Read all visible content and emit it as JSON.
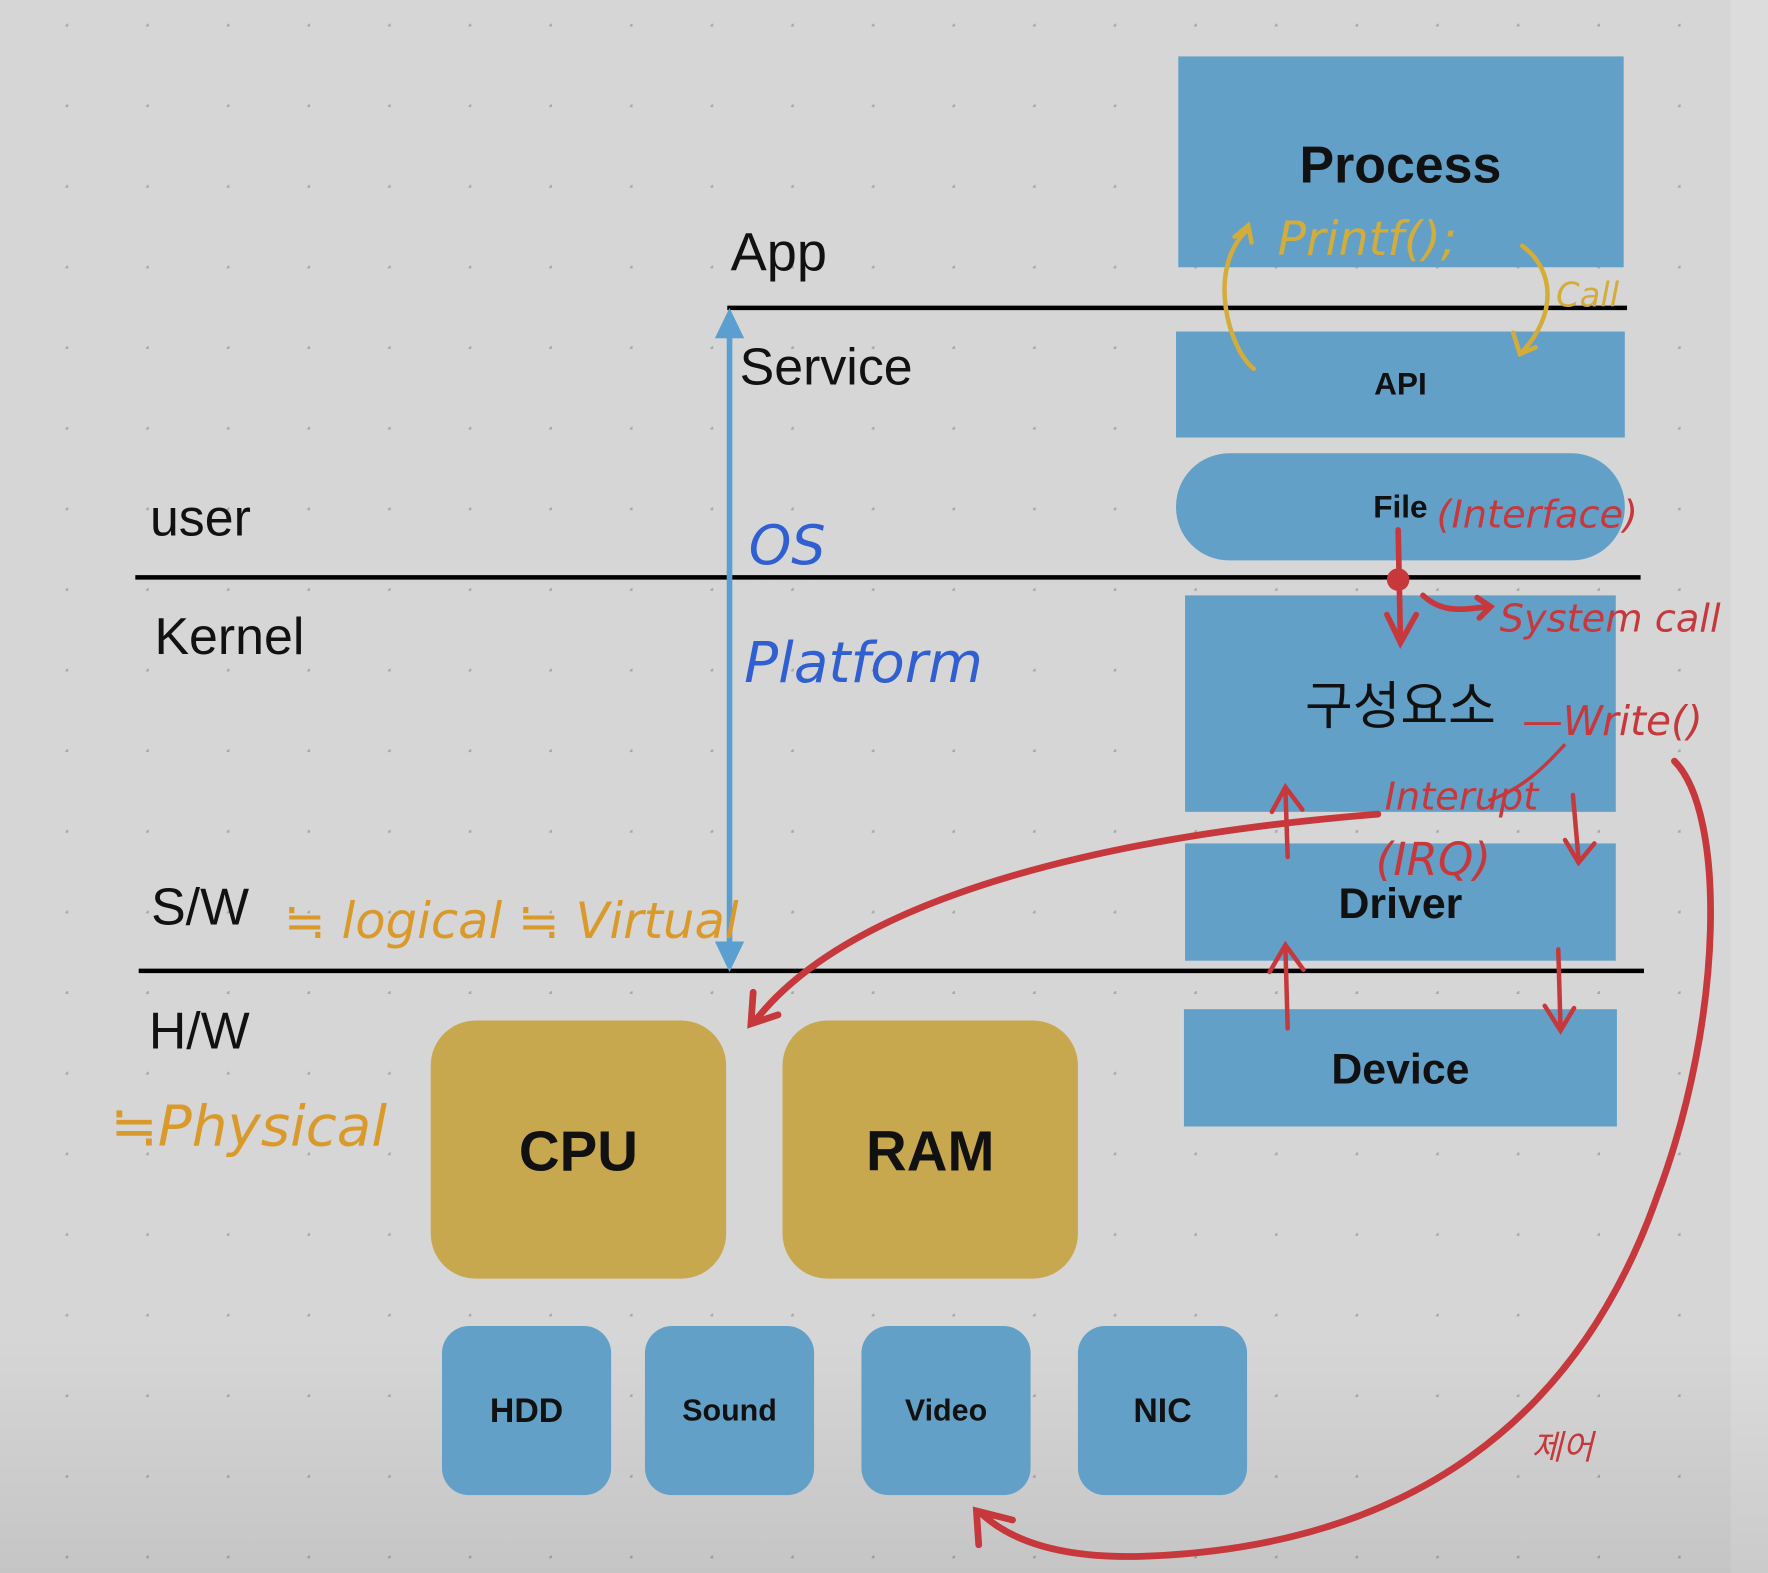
{
  "colors": {
    "background": "#d6d6d6",
    "component_blue": "#62a0c8",
    "hardware_gold": "#c8a84e",
    "annotation_yellow": "#d4ac3a",
    "annotation_orange": "#d99a2b",
    "annotation_red": "#c6383b",
    "annotation_blue": "#2f5fd0",
    "axis_arrow_blue": "#5a9fd0"
  },
  "layers": {
    "app": "App",
    "service": "Service",
    "user": "user",
    "kernel": "Kernel",
    "sw": "S/W",
    "hw": "H/W"
  },
  "stack": {
    "process": "Process",
    "api": "API",
    "file": "File",
    "component": "구성요소",
    "driver": "Driver",
    "device": "Device"
  },
  "hardware": {
    "cpu": "CPU",
    "ram": "RAM",
    "devices": [
      "HDD",
      "Sound",
      "Video",
      "NIC"
    ]
  },
  "annotations": {
    "os": "OS",
    "platform": "Platform",
    "logical": "≒ logical ≒ Virtual",
    "physical": "≒Physical",
    "printf": "Printf();",
    "call": "Call",
    "interface": "(Interface)",
    "system_call": "System call",
    "write": "—Write()",
    "interrupt": "Interupt",
    "irq": "(IRQ)",
    "control": "제어"
  }
}
